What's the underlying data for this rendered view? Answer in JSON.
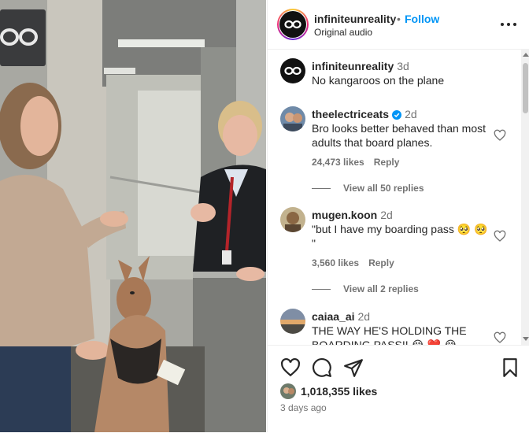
{
  "post": {
    "username": "infiniteunreality",
    "separator": "•",
    "follow_label": "Follow",
    "audio_label": "Original audio",
    "more_icon": "more-horizontal-icon"
  },
  "comments": [
    {
      "username": "infiniteunreality",
      "time": "3d",
      "text": "No kangaroos on the plane"
    },
    {
      "username": "theelectriceats",
      "time": "2d",
      "verified": true,
      "text": "Bro looks better behaved than most adults that board planes.",
      "likes": "24,473 likes",
      "reply_label": "Reply",
      "view_replies": "View all 50 replies"
    },
    {
      "username": "mugen.koon",
      "time": "2d",
      "text": "\"but I have my boarding pass 🥺 🥺 \"",
      "likes": "3,560 likes",
      "reply_label": "Reply",
      "view_replies": "View all 2 replies"
    },
    {
      "username": "caiaa_ai",
      "time": "2d",
      "text": "THE WAY HE'S HOLDING THE BOARDING PASS!! 😭 ❤️ 😭"
    }
  ],
  "footer": {
    "likes_count": "1,018,355 likes",
    "posted_ago": "3 days ago",
    "icons": [
      "heart-icon",
      "comment-icon",
      "share-icon",
      "bookmark-icon"
    ]
  },
  "colors": {
    "follow_blue": "#0095f6",
    "verified_blue": "#0095f6",
    "secondary_text": "#737373"
  }
}
